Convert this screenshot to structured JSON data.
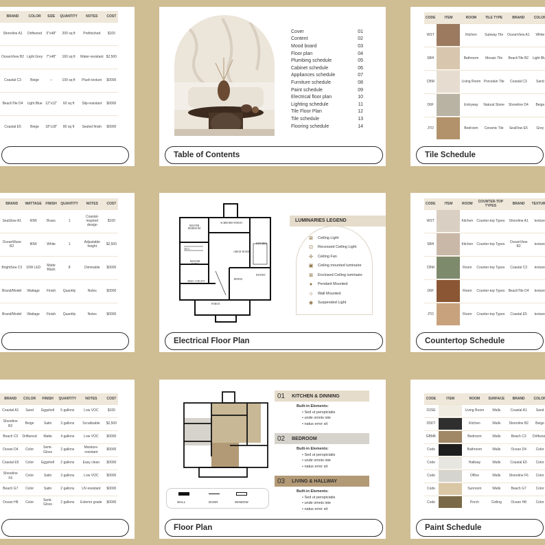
{
  "cards": {
    "plumbing": {
      "title": "",
      "headers": [
        "BRAND",
        "COLOR",
        "SIZE",
        "QUANTITY",
        "NOTES",
        "COST"
      ],
      "rows": [
        [
          "Shoreline A1",
          "Driftwood",
          "5\"x48\"",
          "200 sq ft",
          "Prefinished",
          "$100"
        ],
        [
          "OceanView B2",
          "Light Grey",
          "7\"x48\"",
          "160 sq ft",
          "Water-resistant",
          "$2,500"
        ],
        [
          "Coastal C3",
          "Beige",
          "–",
          "100 sq ft",
          "Plush texture",
          "$0000"
        ],
        [
          "BeachTile D4",
          "Light Blue",
          "12\"x12\"",
          "60 sq ft",
          "Slip-resistant",
          "$0000"
        ],
        [
          "Coastal E5",
          "Beige",
          "18\"x18\"",
          "80 sq ft",
          "Sealed finish",
          "$0000"
        ]
      ]
    },
    "toc": {
      "title": "Table of Contents",
      "items": [
        {
          "label": "Cover",
          "num": "01"
        },
        {
          "label": "Content",
          "num": "02"
        },
        {
          "label": "Mood board",
          "num": "03"
        },
        {
          "label": "Floor plan",
          "num": "04"
        },
        {
          "label": "Plumbing schedule",
          "num": "05"
        },
        {
          "label": "Cabinet schedule",
          "num": "06"
        },
        {
          "label": "Appliances schedule",
          "num": "07"
        },
        {
          "label": "Furniture schedule",
          "num": "08"
        },
        {
          "label": "Paint schedule",
          "num": "09"
        },
        {
          "label": "Electrical floor plan",
          "num": "10"
        },
        {
          "label": "Lighting schedule",
          "num": "11"
        },
        {
          "label": "Tile Floor Plan",
          "num": "12"
        },
        {
          "label": "Tile schedule",
          "num": "13"
        },
        {
          "label": "Flooring schedule",
          "num": "14"
        }
      ]
    },
    "tile": {
      "title": "Tile Schedule",
      "headers": [
        "CODE",
        "ITEM",
        "ROOM",
        "TILE TYPE",
        "BRAND",
        "COLOR"
      ],
      "rows": [
        {
          "code": "WST",
          "room": "Kitchen",
          "type": "Subway Tile",
          "brand": "OceanView A1",
          "color": "White",
          "swatch": "#9b7a5f"
        },
        {
          "code": "SBH",
          "room": "Bathroom",
          "type": "Mosaic Tile",
          "brand": "BeachTile B2",
          "color": "Light Blue",
          "swatch": "#d8c7ae"
        },
        {
          "code": "CBM",
          "room": "Living Room",
          "type": "Porcelain Tile",
          "brand": "Coastal C3",
          "color": "Sand",
          "swatch": "#e6ddd0"
        },
        {
          "code": "D6F",
          "room": "Entryway",
          "type": "Natural Stone",
          "brand": "Shoreline D4",
          "color": "Beige",
          "swatch": "#b9b3a4"
        },
        {
          "code": "JTD",
          "room": "Bedroom",
          "type": "Ceramic Tile",
          "brand": "SeaFlow E5",
          "color": "Grey",
          "swatch": "#b2926a"
        }
      ]
    },
    "lighting": {
      "headers": [
        "BRAND",
        "WATTAGE",
        "FINISH",
        "QUANTITY",
        "NOTES",
        "COST"
      ],
      "rows": [
        [
          "SeaGlow A1",
          "60W",
          "Brass",
          "1",
          "Coastal-inspired design",
          "$100"
        ],
        [
          "OceanWave B2",
          "80W",
          "White",
          "1",
          "Adjustable height",
          "$2,500"
        ],
        [
          "BrightSea C3",
          "10W LED",
          "Matte Black",
          "8",
          "Dimmable",
          "$0000"
        ],
        [
          "Brand/Model",
          "Wattage",
          "Finish",
          "Quantity",
          "Notes",
          "$0000"
        ],
        [
          "Brand/Model",
          "Wattage",
          "Finish",
          "Quantity",
          "Notes",
          "$0000"
        ]
      ]
    },
    "electrical": {
      "title": "Electrical Floor Plan",
      "legend_title": "LUMINARIES LEGEND",
      "legend": [
        {
          "icon": "ceiling-light-icon",
          "glyph": "⊠",
          "label": "Ceiling Light"
        },
        {
          "icon": "recessed-light-icon",
          "glyph": "⊡",
          "label": "Recessed Ceiling Light"
        },
        {
          "icon": "ceiling-fan-icon",
          "glyph": "✣",
          "label": "Ceiling Fan"
        },
        {
          "icon": "ceiling-mounted-luminaire-icon",
          "glyph": "▣",
          "label": "Ceiling mounted luminaire"
        },
        {
          "icon": "enclosed-luminaire-icon",
          "glyph": "⊠",
          "label": "Enclosed Ceiling  luminaire"
        },
        {
          "icon": "pendant-icon",
          "glyph": "●",
          "label": "Pendant Mounted"
        },
        {
          "icon": "wall-mounted-icon",
          "glyph": "⊹",
          "label": "Wall Mounted"
        },
        {
          "icon": "suspended-light-icon",
          "glyph": "◉",
          "label": "Suspended Light"
        }
      ],
      "rooms": {
        "master_bedroom": "MASTER BEDROOM",
        "screened_porch": "SCREENED PORCH",
        "great_room": "GREAT ROOM",
        "kitchen": "KITCHEN",
        "master_bath": "MASTER BATH",
        "wic": "W.I.C.",
        "mud_utility": "MUD / UTILITY",
        "dining": "DINING",
        "pantry": "PANTRY",
        "porch": "PORCH"
      }
    },
    "countertop": {
      "title": "Countertop Schedule",
      "headers": [
        "CODE",
        "ITEM",
        "ROOM",
        "COUNTER-TOP TYPES",
        "BRAND",
        "TEXTURE"
      ],
      "rows": [
        {
          "code": "WST",
          "room": "Kitchen",
          "type": "Counter-top Types",
          "brand": "Shoreline A1",
          "texture": "texture",
          "swatch": "#d9cfc2"
        },
        {
          "code": "SBH",
          "room": "Kitchen",
          "type": "Counter-top Types",
          "brand": "OceanView B2",
          "texture": "texture",
          "swatch": "#c9b8a8"
        },
        {
          "code": "CBM",
          "room": "Room",
          "type": "Counter-top Types",
          "brand": "Coastal C3",
          "texture": "texture",
          "swatch": "#7e8a6c"
        },
        {
          "code": "D6F",
          "room": "Room",
          "type": "Counter-top Types",
          "brand": "BeachTile D4",
          "texture": "texture",
          "swatch": "#8a5634"
        },
        {
          "code": "JTD",
          "room": "Room",
          "type": "Counter-top Types",
          "brand": "Coastal E5",
          "texture": "texture",
          "swatch": "#c7a27c"
        }
      ]
    },
    "paint_left": {
      "headers": [
        "BRAND",
        "COLOR",
        "FINISH",
        "QUANTITY",
        "NOTES",
        "COST"
      ],
      "rows": [
        [
          "Coastal A1",
          "Sand",
          "Eggshell",
          "5 gallons",
          "Low VOC",
          "$100"
        ],
        [
          "Shoreline B2",
          "Beige",
          "Satin",
          "3 gallons",
          "Scrubbable",
          "$2,500"
        ],
        [
          "Beach C3",
          "Driftwood",
          "Matte",
          "4 gallons",
          "Low VOC",
          "$0000"
        ],
        [
          "Ocean D4",
          "Color",
          "Semi-Gloss",
          "2 gallons",
          "Moisture-resistant",
          "$0000"
        ],
        [
          "Coastal E5",
          "Color",
          "Eggshell",
          "2 gallons",
          "Easy clean",
          "$0000"
        ],
        [
          "Shoreline F6",
          "Color",
          "Satin",
          "3 gallons",
          "Low VOC",
          "$0000"
        ],
        [
          "Beach G7",
          "Color",
          "Satin",
          "2 gallons",
          "UV-resistant",
          "$0000"
        ],
        [
          "Ocean H8",
          "Color",
          "Semi-Gloss",
          "2 gallons",
          "Exterior grade",
          "$0000"
        ]
      ]
    },
    "floor": {
      "title": "Floor Plan",
      "legend": [
        "WALL",
        "DOOR",
        "WINDOW"
      ],
      "sections": [
        {
          "num": "01",
          "name": "KITCHEN & DINNING",
          "color": "#e6dccb",
          "sub": "Built-in Elements:",
          "bullets": [
            "Sed ut perspiciatis",
            "unde omnis iste",
            "natus error sit"
          ]
        },
        {
          "num": "02",
          "name": "BEDROOM",
          "color": "#d6d3cc",
          "sub": "Built-in Elements:",
          "bullets": [
            "Sed ut perspiciatis",
            "unde omnis iste",
            "natus error sit"
          ]
        },
        {
          "num": "03",
          "name": "LIVING & HALLWAY",
          "color": "#b39a76",
          "sub": "Built-in Elements:",
          "bullets": [
            "Sed ut perspiciatis",
            "unde omnis iste",
            "natus error sit"
          ]
        }
      ]
    },
    "paint": {
      "title": "Paint Schedule",
      "headers": [
        "CODE",
        "ITEM",
        "ROOM",
        "SURFACE",
        "BRAND",
        "COLOR"
      ],
      "rows": [
        {
          "code": "D2SE",
          "room": "Living Room",
          "surface": "Walls",
          "brand": "Coastal A1",
          "color": "Sand",
          "swatch": "#f1ece2"
        },
        {
          "code": "D5DT",
          "room": "Kitchen",
          "surface": "Walls",
          "brand": "Shoreline B2",
          "color": "Beige",
          "swatch": "#2f2f2f"
        },
        {
          "code": "GBMK",
          "room": "Bedroom",
          "surface": "Walls",
          "brand": "Beach C3",
          "color": "Driftwood",
          "swatch": "#a08766"
        },
        {
          "code": "Code",
          "room": "Bathroom",
          "surface": "Walls",
          "brand": "Ocean D4",
          "color": "Color",
          "swatch": "#1e1e1e"
        },
        {
          "code": "Code",
          "room": "Hallway",
          "surface": "Walls",
          "brand": "Coastal E5",
          "color": "Color",
          "swatch": "#e8e6e0"
        },
        {
          "code": "Code",
          "room": "Office",
          "surface": "Walls",
          "brand": "Shoreline F6",
          "color": "Color",
          "swatch": "#d6d4cf"
        },
        {
          "code": "Code",
          "room": "Sunroom",
          "surface": "Walls",
          "brand": "Beach G7",
          "color": "Color",
          "swatch": "#d9c7a6"
        },
        {
          "code": "Code",
          "room": "Porch",
          "surface": "Ceiling",
          "brand": "Ocean H8",
          "color": "Color",
          "swatch": "#7a6a48"
        }
      ]
    }
  }
}
